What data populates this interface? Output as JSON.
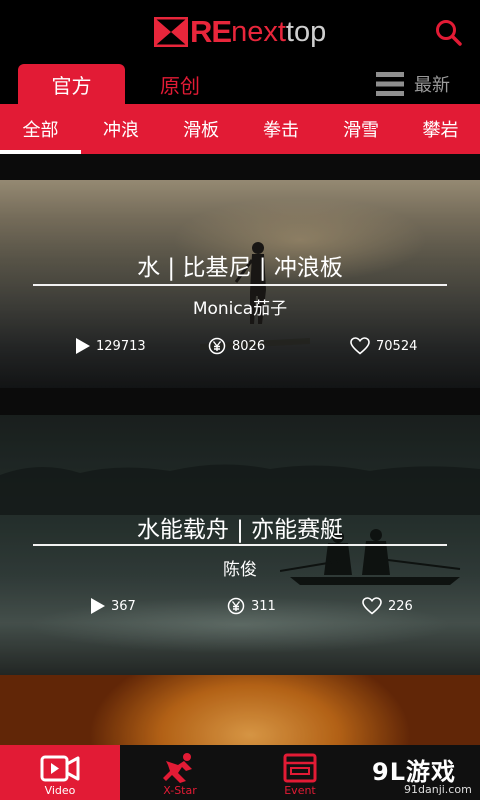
{
  "header": {
    "logo_re": "RE",
    "logo_next": "next",
    "logo_top": "top",
    "search_icon": "search-icon",
    "accent": "#e21b35"
  },
  "tabs": [
    {
      "label": "官方",
      "active": true
    },
    {
      "label": "原创",
      "active": false
    }
  ],
  "sort": {
    "icon": "list-icon",
    "label": "最新"
  },
  "categories": [
    {
      "label": "全部",
      "active": true
    },
    {
      "label": "冲浪"
    },
    {
      "label": "滑板"
    },
    {
      "label": "拳击"
    },
    {
      "label": "滑雪"
    },
    {
      "label": "攀岩"
    }
  ],
  "videos": [
    {
      "title": "水 | 比基尼 | 冲浪板",
      "author": "Monica茄子",
      "plays": "129713",
      "coins": "8026",
      "likes": "70524"
    },
    {
      "title": "水能载舟 | 亦能赛艇",
      "author": "陈俊",
      "plays": "367",
      "coins": "311",
      "likes": "226"
    }
  ],
  "bottom_nav": [
    {
      "label": "Video",
      "icon": "video-icon",
      "active": true
    },
    {
      "label": "X-Star",
      "icon": "xstar-icon",
      "active": false
    },
    {
      "label": "Event",
      "icon": "event-icon",
      "active": false
    }
  ],
  "watermark": {
    "main": "9L游戏",
    "sub": "91danji.com"
  }
}
